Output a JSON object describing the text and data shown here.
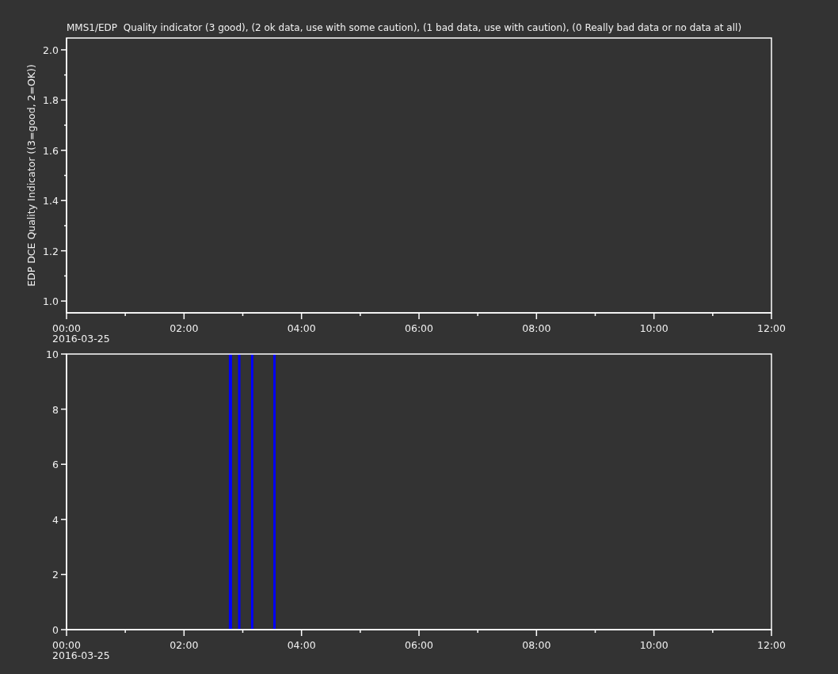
{
  "plots": [
    {
      "date_label": "2016-03-25",
      "chart_data": {
        "type": "line",
        "title": "MMS1/EDP  Quality indicator (3 good), (2 ok data, use with some caution), (1 bad data, use with caution), (0 Really bad data or no data at all)",
        "ylabel": "EDP DCE Quality Indicator ((3=good, 2=OK))",
        "xlim": [
          0,
          12
        ],
        "ylim": [
          0.953,
          2.047
        ],
        "xticks": [
          {
            "value": 0,
            "label": "00:00"
          },
          {
            "value": 2,
            "label": "02:00"
          },
          {
            "value": 4,
            "label": "04:00"
          },
          {
            "value": 6,
            "label": "06:00"
          },
          {
            "value": 8,
            "label": "08:00"
          },
          {
            "value": 10,
            "label": "10:00"
          },
          {
            "value": 12,
            "label": "12:00"
          }
        ],
        "yticks": [
          {
            "value": 1,
            "label": "1.0"
          },
          {
            "value": 1.2,
            "label": "1.2"
          },
          {
            "value": 1.4,
            "label": "1.4"
          },
          {
            "value": 1.6,
            "label": "1.6"
          },
          {
            "value": 1.8,
            "label": "1.8"
          },
          {
            "value": 2,
            "label": "2.0"
          }
        ]
      }
    },
    {
      "date_label": "2016-03-25",
      "chart_data": {
        "type": "bar",
        "xlim": [
          0,
          12
        ],
        "ylim": [
          0,
          10
        ],
        "xticks": [
          {
            "value": 0,
            "label": "00:00"
          },
          {
            "value": 2,
            "label": "02:00"
          },
          {
            "value": 4,
            "label": "04:00"
          },
          {
            "value": 6,
            "label": "06:00"
          },
          {
            "value": 8,
            "label": "08:00"
          },
          {
            "value": 10,
            "label": "10:00"
          },
          {
            "value": 12,
            "label": "12:00"
          }
        ],
        "yticks": [
          0,
          2,
          4,
          6,
          8,
          10
        ],
        "x": [
          2.79,
          2.94,
          3.16,
          3.54
        ],
        "series": [
          {
            "color": "#0000ff",
            "values": [
              10,
              10,
              10,
              10
            ]
          }
        ]
      }
    }
  ]
}
